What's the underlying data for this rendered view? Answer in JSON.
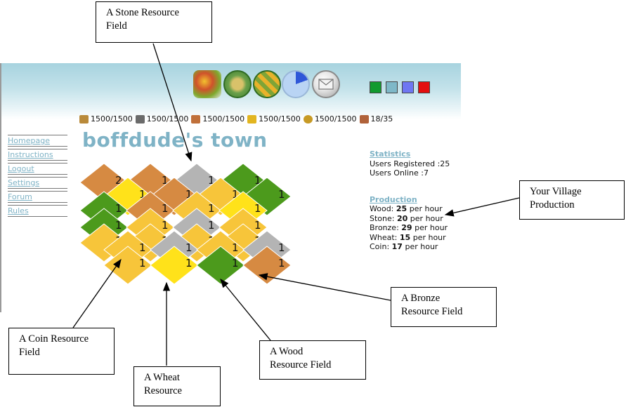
{
  "nav_icons": [
    "resource-map-icon",
    "village-map-icon",
    "fields-icon",
    "statistics-pie-icon",
    "messages-envelope-icon"
  ],
  "color_swatches": [
    "#119a2f",
    "#7eb8c8",
    "#6f77f2",
    "#e40f0f"
  ],
  "resources": [
    {
      "icon": "wood-logs-icon",
      "amount": "1500/1500"
    },
    {
      "icon": "stone-icon",
      "amount": "1500/1500"
    },
    {
      "icon": "bronze-bar-icon",
      "amount": "1500/1500"
    },
    {
      "icon": "wheat-icon",
      "amount": "1500/1500"
    },
    {
      "icon": "coin-icon",
      "amount": "1500/1500"
    },
    {
      "icon": "population-icon",
      "amount": "18/35"
    }
  ],
  "town_title": "boffdude's town",
  "nav_links": [
    "Homepage",
    "Instructions",
    "Logout",
    "Settings",
    "Forum",
    "Rules"
  ],
  "statistics": {
    "title": "Statistics",
    "registered_label": "Users Registered :25",
    "online_label": "Users Online :7"
  },
  "production": {
    "title": "Production",
    "rows": [
      {
        "label": "Wood:",
        "value": "25",
        "unit": "per hour"
      },
      {
        "label": "Stone:",
        "value": "20",
        "unit": "per hour"
      },
      {
        "label": "Bronze:",
        "value": "29",
        "unit": "per hour"
      },
      {
        "label": "Wheat:",
        "value": "15",
        "unit": "per hour"
      },
      {
        "label": "Coin:",
        "value": "17",
        "unit": "per hour"
      }
    ]
  },
  "colors": {
    "wood": "#4c9a1c",
    "stone": "#b4b4b4",
    "bronze": "#d68a42",
    "wheat": "#ffe21a",
    "coin": "#f7c53a"
  },
  "board": {
    "rows": [
      [
        {
          "type": "bronze",
          "level": "2"
        },
        {
          "type": "bronze",
          "level": "1"
        },
        {
          "type": "stone",
          "level": "1"
        },
        {
          "type": "wood",
          "level": "1"
        }
      ],
      [
        {
          "type": "wheat",
          "level": "1"
        },
        {
          "type": "bronze",
          "level": "1"
        },
        {
          "type": "coin",
          "level": "1"
        },
        {
          "type": "wood",
          "level": "1"
        }
      ],
      [
        {
          "type": "wood",
          "level": "1"
        },
        {
          "type": "bronze",
          "level": "1"
        },
        {
          "type": "coin",
          "level": "1"
        },
        {
          "type": "wheat",
          "level": "1"
        }
      ],
      [
        {
          "type": "wood",
          "level": "1"
        },
        {
          "type": "coin",
          "level": "1"
        },
        {
          "type": "stone",
          "level": "1"
        },
        {
          "type": "coin",
          "level": "1"
        }
      ],
      [
        {
          "type": "coin",
          "level": "1"
        },
        {
          "type": "coin",
          "level": "1"
        },
        {
          "type": "coin",
          "level": "1"
        },
        {
          "type": "coin",
          "level": "1"
        }
      ],
      [
        {
          "type": "coin",
          "level": "1"
        },
        {
          "type": "stone",
          "level": "1"
        },
        {
          "type": "coin",
          "level": "1"
        },
        {
          "type": "stone",
          "level": "1"
        }
      ],
      [
        {
          "type": "coin",
          "level": "1"
        },
        {
          "type": "wheat",
          "level": "1"
        },
        {
          "type": "wood",
          "level": "1"
        },
        {
          "type": "bronze",
          "level": "1"
        }
      ]
    ]
  },
  "callouts": {
    "stone": [
      "A Stone Resource",
      "Field"
    ],
    "village": [
      "Your Village",
      "Production"
    ],
    "bronze": [
      "A Bronze",
      "Resource Field"
    ],
    "coin": [
      "A Coin Resource",
      "Field"
    ],
    "wood": [
      "A Wood",
      "Resource Field"
    ],
    "wheat": [
      "A Wheat",
      "Resource"
    ]
  }
}
